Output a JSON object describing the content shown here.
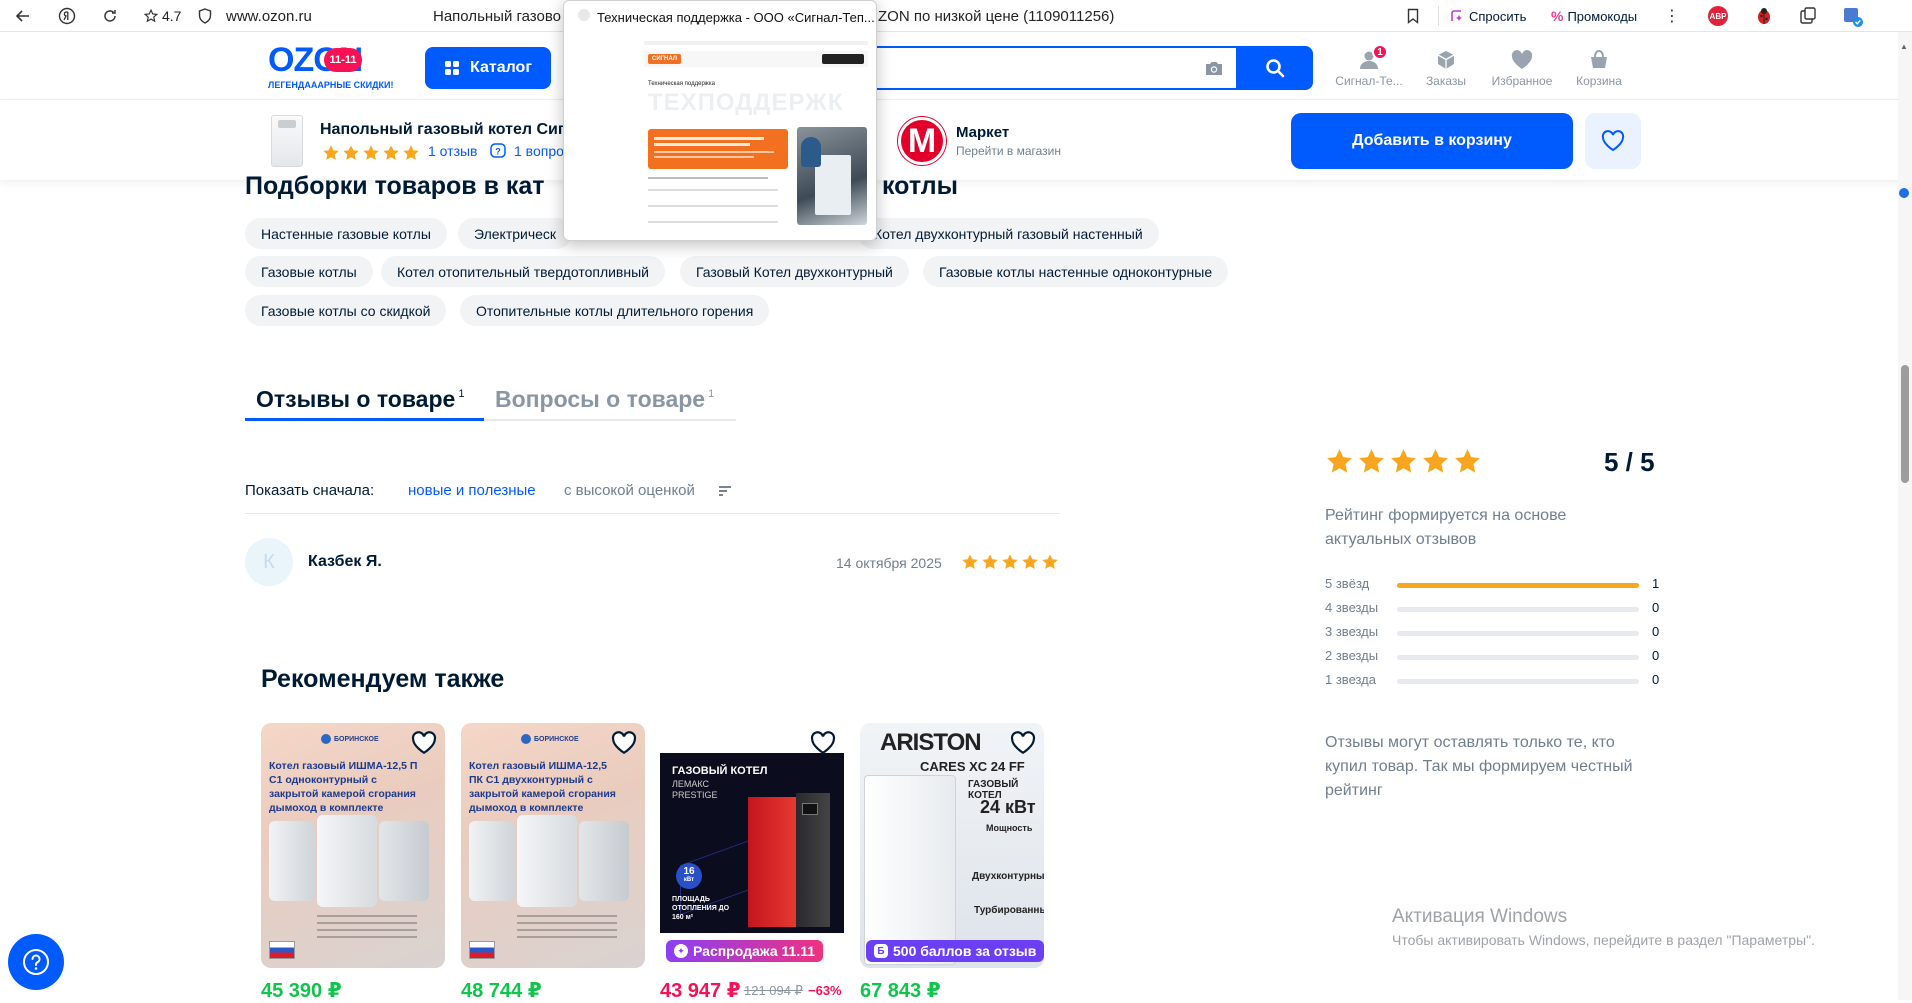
{
  "browser": {
    "rating": "4.7",
    "domain": "www.ozon.ru",
    "tab_title_left": "Напольный газово",
    "tab_title_right": "ZON по низкой цене (1109011256)",
    "ask_label": "Спросить",
    "promo_label": "Промокоды",
    "abp_label": "ABP"
  },
  "tab_preview": {
    "title": "Техническая поддержка - ООО «Сигнал-Теп...",
    "page_heading": "Техническая поддержка",
    "watermark": "ТЕХПОДДЕРЖК",
    "brand": "СИГНАЛ"
  },
  "header": {
    "logo": "OZON",
    "logo_badge": "11-11",
    "logo_tagline": "ЛЕГЕНДАААРНЫЕ СКИДКИ!",
    "catalog_label": "Каталог",
    "nav": [
      {
        "label": "Сигнал-Те...",
        "icon": "user-icon",
        "badge": "1"
      },
      {
        "label": "Заказы",
        "icon": "box-icon"
      },
      {
        "label": "Избранное",
        "icon": "heart-icon"
      },
      {
        "label": "Корзина",
        "icon": "cart-icon"
      }
    ]
  },
  "product_bar": {
    "title": "Напольный газовый котел Сигн",
    "reviews_link": "1 отзыв",
    "questions_link": "1 вопро",
    "rating": 5,
    "seller_name": "Маркет",
    "seller_sub": "Перейти в магазин",
    "seller_logo_letter": "M",
    "add_to_cart": "Добавить в корзину"
  },
  "collections": {
    "heading_left": "Подборки товаров в кат",
    "heading_right": "котлы",
    "chips": [
      "Настенные газовые котлы",
      "Электрическ",
      "Котел двухконтурный газовый настенный",
      "Газовые котлы",
      "Котел отопительный твердотопливный",
      "Газовый Котел двухконтурный",
      "Газовые котлы настенные одноконтурные",
      "Газовые котлы со скидкой",
      "Отопительные котлы длительного горения"
    ]
  },
  "tabs": {
    "reviews": "Отзывы о товаре",
    "reviews_count": "1",
    "questions": "Вопросы о товаре",
    "questions_count": "1"
  },
  "sort": {
    "label": "Показать сначала:",
    "active": "новые и полезные",
    "other": "с высокой оценкой"
  },
  "review": {
    "avatar_letter": "К",
    "author": "Казбек Я.",
    "date": "14 октября 2025",
    "rating": 5
  },
  "rating_widget": {
    "score": "5 / 5",
    "stars": 5,
    "note": "Рейтинг формируется на основе актуальных отзывов",
    "distribution": [
      {
        "label": "5 звёзд",
        "count": "1",
        "fraction": 1.0
      },
      {
        "label": "4 звезды",
        "count": "0",
        "fraction": 0
      },
      {
        "label": "3 звезды",
        "count": "0",
        "fraction": 0
      },
      {
        "label": "2 звезды",
        "count": "0",
        "fraction": 0
      },
      {
        "label": "1 звезда",
        "count": "0",
        "fraction": 0
      }
    ],
    "footer": "Отзывы могут оставлять только те, кто купил товар. Так мы формируем честный рейтинг"
  },
  "recommend": {
    "heading": "Рекомендуем также",
    "cards": [
      {
        "img_title": "Котел газовый ИШМА-12,5 П С1 одноконтурный с закрытой камерой сгорания дымоход в комплекте",
        "brand": "БОРИНСКОЕ",
        "price": "45 390 ₽"
      },
      {
        "img_title": "Котел газовый ИШМА-12,5 ПК С1 двухконтурный с закрытой камерой сгорания дымоход в комплекте",
        "brand": "БОРИНСКОЕ",
        "price": "48 744 ₽"
      },
      {
        "img_title": "ГАЗОВЫЙ КОТЕЛ",
        "img_sub1": "ЛЕМАКС",
        "img_sub2": "PRESTIGE",
        "power_num": "16",
        "power_unit": "кВт",
        "area_text": "ПЛОЩАДЬ ОТОПЛЕНИЯ ДО 160 м²",
        "badge": "Распродажа 11.11",
        "price": "43 947 ₽",
        "old_price": "121 094 ₽",
        "discount": "−63%"
      },
      {
        "brand": "ARISTON",
        "model": "CARES XC 24 FF",
        "subtitle": "ГАЗОВЫЙ КОТЕЛ",
        "power": "24 кВт",
        "power_label": "Мощность",
        "feature1": "Двухконтурный",
        "feature2": "Турбированный",
        "badge": "500 баллов за отзыв",
        "price": "67 843 ₽"
      }
    ]
  },
  "windows_watermark": {
    "title": "Активация Windows",
    "subtitle": "Чтобы активировать Windows, перейдите в раздел \"Параметры\"."
  },
  "colors": {
    "brand_blue": "#005bff",
    "price_green": "#10c44c",
    "price_red": "#f91155",
    "star": "#f9a61f"
  }
}
